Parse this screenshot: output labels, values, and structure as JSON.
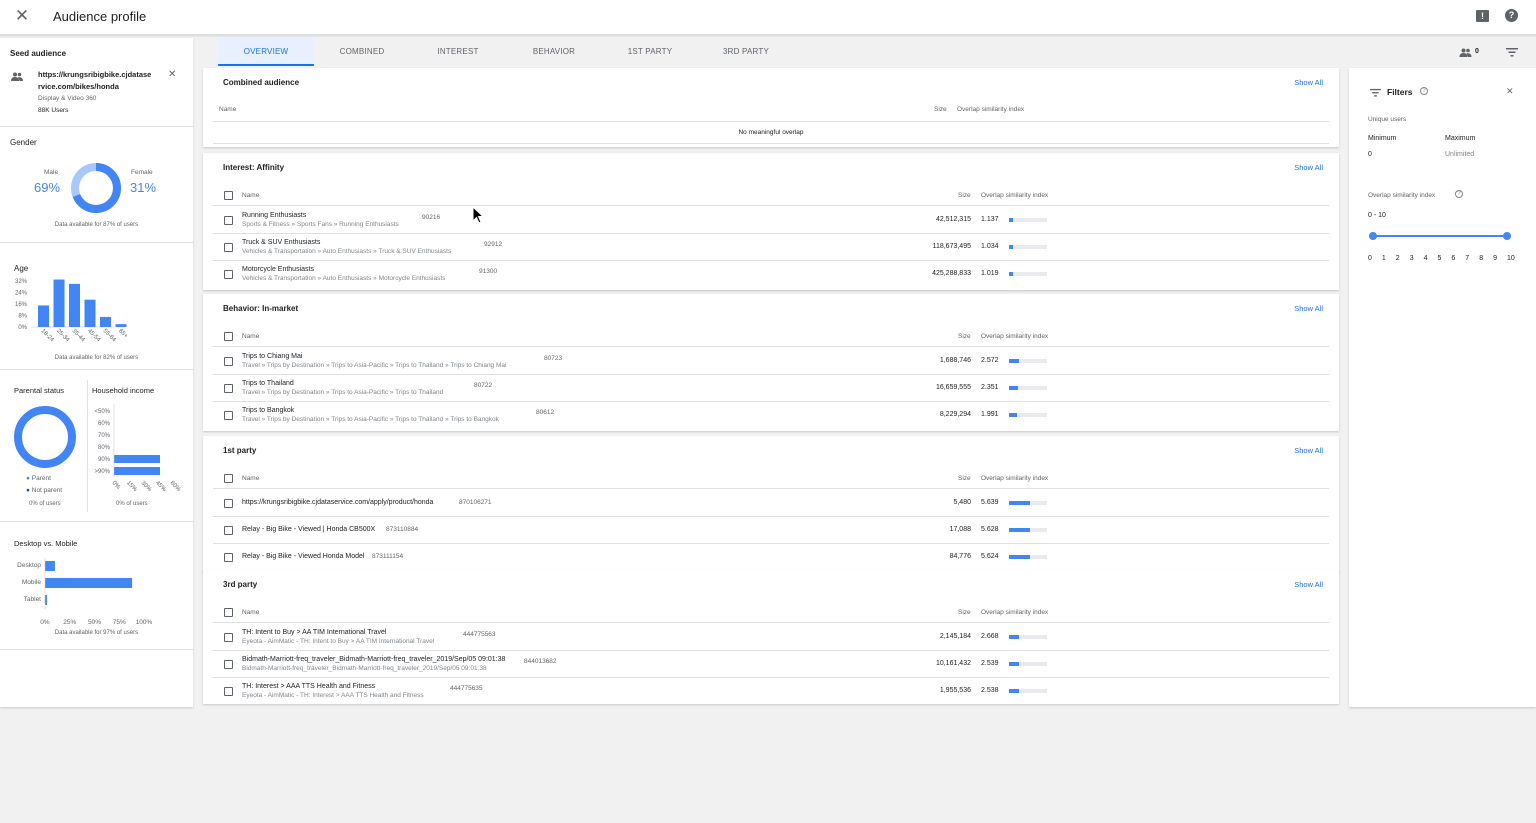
{
  "topbar": {
    "title": "Audience profile",
    "feedback_icon": "feedback-icon",
    "help_icon": "help-icon"
  },
  "seed": {
    "heading": "Seed audience",
    "url_line1": "https://krungsribigbike.cjdatase",
    "url_line2": "rvice.com/bikes/honda",
    "source": "Display & Video 360",
    "users": "88K Users"
  },
  "gender": {
    "heading": "Gender",
    "male_label": "Male",
    "male_value": "69%",
    "female_label": "Female",
    "female_value": "31%",
    "male_fraction": 0.69,
    "note": "Data available for 87% of users"
  },
  "age": {
    "heading": "Age",
    "ticks": [
      "32%",
      "24%",
      "16%",
      "8%",
      "0%"
    ],
    "categories": [
      "18-24",
      "25-34",
      "35-44",
      "45-54",
      "55-64",
      "65+"
    ],
    "values": [
      15,
      33,
      30,
      19,
      7,
      2
    ],
    "max": 32,
    "note": "Data available for 82% of users"
  },
  "parental": {
    "heading": "Parental status",
    "legend_parent": "Parent",
    "legend_not_parent": "Not parent",
    "note": "0% of users"
  },
  "income": {
    "heading": "Household income",
    "categories": [
      "<50%",
      "60%",
      "70%",
      "80%",
      "90%",
      ">90%"
    ],
    "values": [
      0,
      0,
      0,
      0,
      100,
      100
    ],
    "xticks": [
      "0%",
      "15%",
      "30%",
      "45%",
      "60%"
    ],
    "note": "0% of users"
  },
  "device": {
    "heading": "Desktop vs. Mobile",
    "categories": [
      "Desktop",
      "Mobile",
      "Tablet"
    ],
    "values": [
      10,
      88,
      2
    ],
    "xticks": [
      "0%",
      "25%",
      "50%",
      "75%",
      "100%"
    ],
    "note": "Data available for 97% of users"
  },
  "tabs": [
    "OVERVIEW",
    "COMBINED",
    "INTEREST",
    "BEHAVIOR",
    "1ST PARTY",
    "3RD PARTY"
  ],
  "people_count": "0",
  "columns": {
    "name": "Name",
    "size": "Size",
    "osi": "Overlap similarity index"
  },
  "show_all": "Show All",
  "combined": {
    "title": "Combined audience",
    "empty": "No meaningful overlap"
  },
  "cards": [
    {
      "title": "Interest: Affinity",
      "rows": [
        {
          "name": "Running Enthusiasts",
          "path": "Sports & Fitness » Sports Fans » Running Enthusiasts",
          "id": "90216",
          "size": "42,512,315",
          "osi": "1.137",
          "score": 1.137
        },
        {
          "name": "Truck & SUV Enthusiasts",
          "path": "Vehicles & Transportation » Auto Enthusiasts » Truck & SUV Enthusiasts",
          "id": "92912",
          "size": "118,673,495",
          "osi": "1.034",
          "score": 1.034
        },
        {
          "name": "Motorcycle Enthusiasts",
          "path": "Vehicles & Transportation » Auto Enthusiasts » Motorcycle Enthusiasts",
          "id": "91300",
          "size": "425,288,833",
          "osi": "1.019",
          "score": 1.019
        }
      ]
    },
    {
      "title": "Behavior: In-market",
      "rows": [
        {
          "name": "Trips to Chiang Mai",
          "path": "Travel » Trips by Destination » Trips to Asia-Pacific » Trips to Thailand » Trips to Chiang Mai",
          "id": "80723",
          "size": "1,688,746",
          "osi": "2.572",
          "score": 2.572
        },
        {
          "name": "Trips to Thailand",
          "path": "Travel » Trips by Destination » Trips to Asia-Pacific » Trips to Thailand",
          "id": "80722",
          "size": "16,659,555",
          "osi": "2.351",
          "score": 2.351
        },
        {
          "name": "Trips to Bangkok",
          "path": "Travel » Trips by Destination » Trips to Asia-Pacific » Trips to Thailand » Trips to Bangkok",
          "id": "80612",
          "size": "8,229,294",
          "osi": "1.991",
          "score": 1.991
        }
      ]
    },
    {
      "title": "1st party",
      "rows": [
        {
          "name": "https://krungsribigbike.cjdataservice.com/apply/product/honda",
          "path": "",
          "id": "870106271",
          "size": "5,480",
          "osi": "5.639",
          "score": 5.639
        },
        {
          "name": "Relay - Big Bike - Viewed | Honda CB500X",
          "path": "",
          "id": "873110884",
          "size": "17,088",
          "osi": "5.628",
          "score": 5.628
        },
        {
          "name": "Relay - Big Bike - Viewed Honda Model",
          "path": "",
          "id": "873111154",
          "size": "84,776",
          "osi": "5.624",
          "score": 5.624
        }
      ]
    },
    {
      "title": "3rd party",
      "rows": [
        {
          "name": "TH: Intent to Buy > AA TIM International Travel",
          "path": "Eyeota - AimMatic - TH: Intent to Buy > AA TIM International Travel",
          "id": "444775563",
          "size": "2,145,184",
          "osi": "2.668",
          "score": 2.668
        },
        {
          "name": "Bidmath-Marriott-freq_traveler_Bidmath-Marriott-freq_traveler_2019/Sep/05 09:01:38",
          "path": "Bidmath-Marriott-freq_traveler_Bidmath-Marriott-freq_traveler_2019/Sep/05 09:01:38",
          "id": "844013682",
          "size": "10,161,432",
          "osi": "2.539",
          "score": 2.539
        },
        {
          "name": "TH: Interest > AAA TTS Health and Fitness",
          "path": "Eyeota - AimMatic - TH: Interest > AAA TTS Health and Fitness",
          "id": "444775635",
          "size": "1,955,536",
          "osi": "2.538",
          "score": 2.538
        }
      ]
    }
  ],
  "filters": {
    "title": "Filters",
    "unique_users": "Unique users",
    "min_label": "Minimum",
    "max_label": "Maximum",
    "min_value": "0",
    "max_value": "Unlimited",
    "osi_label": "Overlap similarity index",
    "range": "0 - 10",
    "ticks": [
      "0",
      "1",
      "2",
      "3",
      "4",
      "5",
      "6",
      "7",
      "8",
      "9",
      "10"
    ]
  }
}
